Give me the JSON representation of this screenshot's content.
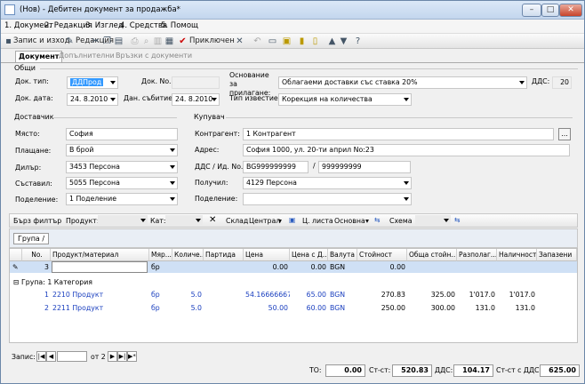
{
  "window": {
    "title": "(Нов) - Дебитен документ за продажба*"
  },
  "menu": [
    "1. Документ",
    "2. Редакция",
    "3. Изглед",
    "4. Средства",
    "5. Помощ"
  ],
  "toolbar": {
    "save_close": "Запис и изход",
    "edit": "Редакция",
    "apply": "Приключен"
  },
  "tabs": [
    "Документ",
    "Допълнителни",
    "Връзки с документи"
  ],
  "general": {
    "title": "Общи",
    "doc_type_label": "Док. тип:",
    "doc_type": "ДДПрод",
    "doc_no_label": "Док. No.",
    "doc_no": "",
    "doc_date_label": "Док. дата:",
    "doc_date": "24. 8.2010",
    "event_date_label": "Дан. събитие:",
    "event_date": "24. 8.2010",
    "reason_label": "Основание за прилагане:",
    "reason": "Облагаеми доставки със ставка 20%",
    "vat_label": "ДДС:",
    "vat": "20",
    "notice_label": "Тип известие:",
    "notice": "Корекция на количества"
  },
  "supplier": {
    "title": "Доставчик",
    "place_label": "Място:",
    "place": "София",
    "payment_label": "Плащане:",
    "payment": "В брой",
    "dealer_label": "Дилър:",
    "dealer": "3453 Персона",
    "author_label": "Съставил:",
    "author": "5055 Персона",
    "division_label": "Поделение:",
    "division": "1 Поделение"
  },
  "buyer": {
    "title": "Купувач",
    "contragent_label": "Контрагент:",
    "contragent": "1 Контрагент",
    "address_label": "Адрес:",
    "address": "София 1000, ул. 20-ти април No:23",
    "vat_id_label": "ДДС / Ид. No.",
    "vat_no": "BG999999999",
    "slash": "/",
    "id_no": "999999999",
    "receiver_label": "Получил:",
    "receiver": "4129 Персона",
    "division_label": "Поделение:",
    "division": ""
  },
  "filterbar": {
    "quick": "Бърз филтър",
    "product": "Продукт:",
    "cat": "Кат:",
    "store_label": "Склад",
    "store": "Централ",
    "price_list_label": "Ц. листа",
    "price_list": "Основна",
    "schema_label": "Схема"
  },
  "group_tag": "Група /",
  "grid": {
    "headers": [
      "No.",
      "Продукт/материал",
      "Мяр...",
      "Количе...",
      "Партида",
      "Цена",
      "Цена с Д...",
      "Валута",
      "Стойност",
      "Обща стойн...",
      "Разполаг...",
      "Наличност",
      "Запазени"
    ],
    "new_row": {
      "no": "3",
      "unit": "бр",
      "price": "0.00",
      "price_vat": "0.00",
      "currency": "BGN",
      "value": "0.00"
    },
    "group_label": "Група: 1 Категория",
    "rows": [
      {
        "no": "1",
        "product": "2210 Продукт",
        "unit": "бр",
        "qty": "5.0",
        "price": "54.16666667",
        "price_vat": "65.00",
        "currency": "BGN",
        "value": "270.83",
        "total": "325.00",
        "available": "1'017.0",
        "stock": "1'017.0"
      },
      {
        "no": "2",
        "product": "2211 Продукт",
        "unit": "бр",
        "qty": "5.0",
        "price": "50.00",
        "price_vat": "60.00",
        "currency": "BGN",
        "value": "250.00",
        "total": "300.00",
        "available": "131.0",
        "stock": "131.0"
      }
    ]
  },
  "status": {
    "record_label": "Запис:",
    "of": "от 2",
    "to_label": "ТО:",
    "to": "0.00",
    "cost_label": "Ст-ст:",
    "cost": "520.83",
    "vat_label": "ДДС:",
    "vat": "104.17",
    "cost_vat_label": "Ст-ст с ДДС:",
    "cost_vat": "625.00"
  }
}
